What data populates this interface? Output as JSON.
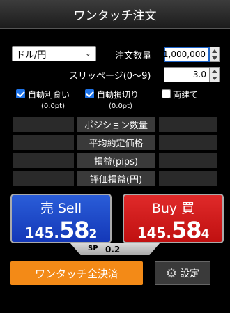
{
  "window": {
    "title": "ワンタッチ注文"
  },
  "pair_select": {
    "value": "ドル/円"
  },
  "order_qty": {
    "label": "注文数量",
    "value": "1,000,000"
  },
  "slippage": {
    "label": "スリッページ(0～9)",
    "value": "3.0"
  },
  "options": {
    "auto_take_profit": {
      "label": "自動利食い",
      "sub": "(0.0pt)",
      "checked": true
    },
    "auto_stop_loss": {
      "label": "自動損切り",
      "sub": "(0.0pt)",
      "checked": true
    },
    "hedge": {
      "label": "両建て",
      "checked": false
    }
  },
  "info_rows": [
    "ポジション数量",
    "平均約定価格",
    "損益(pips)",
    "評価損益(円)"
  ],
  "sell": {
    "label": "売 Sell",
    "price_prefix": "145.",
    "price_big": "58",
    "price_small": "2"
  },
  "buy": {
    "label": "Buy 買",
    "price_prefix": "145.",
    "price_big": "58",
    "price_small": "4"
  },
  "spread": {
    "label": "SP",
    "value": "0.2"
  },
  "buttons": {
    "close_all": "ワンタッチ全決済",
    "settings": "設定"
  },
  "icons": {
    "settings": "gear-icon",
    "select": "chevron-down-icon"
  },
  "colors": {
    "sell": "#1f4ccc",
    "buy": "#d11a1a",
    "close_all": "#f38a17"
  }
}
